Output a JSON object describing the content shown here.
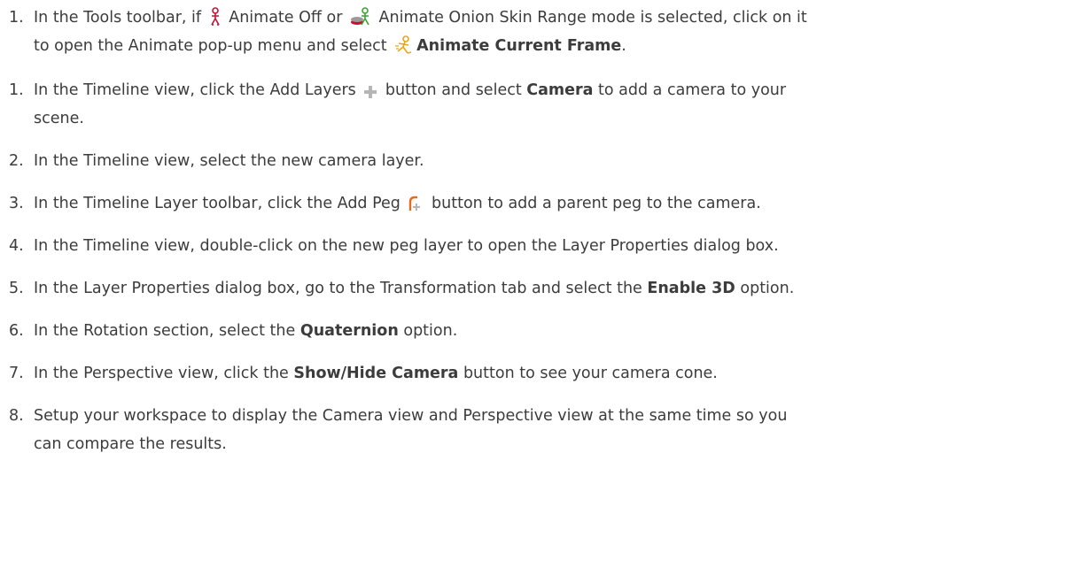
{
  "steps": [
    {
      "number": "1.",
      "pre": "In the Tools toolbar, if ",
      "t1": " Animate Off or ",
      "t2": " Animate Onion Skin Range mode is selected, click on it",
      "line2": "to open the Animate pop-up menu and select ",
      "bold": "Animate Current Frame",
      "end": ".",
      "icons": [
        "animate-off-icon",
        "animate-onion-skin-range-icon",
        "animate-current-frame-icon"
      ]
    },
    {
      "number": "1.",
      "pre": "In the Timeline view, click the Add Layers ",
      "mid": " button and select ",
      "bold": "Camera",
      "post": " to add a camera to your",
      "line2": "scene.",
      "icons": [
        "add-layers-icon"
      ]
    },
    {
      "number": "2.",
      "text": "In the Timeline view, select the new camera layer."
    },
    {
      "number": "3.",
      "pre": "In the Timeline Layer toolbar, click the Add Peg ",
      "post": " button to add a parent peg to the camera.",
      "icons": [
        "add-peg-icon"
      ]
    },
    {
      "number": "4.",
      "text": "In the Timeline view, double-click on the new peg layer to open the Layer Properties dialog box."
    },
    {
      "number": "5.",
      "pre": "In the Layer Properties dialog box, go to the Transformation tab and select the ",
      "bold": "Enable 3D",
      "post": " option."
    },
    {
      "number": "6.",
      "pre": "In the Rotation section, select the ",
      "bold": "Quaternion",
      "post": " option."
    },
    {
      "number": "7.",
      "pre": "In the Perspective view, click the ",
      "bold": "Show/Hide Camera",
      "post": " button to see your camera cone."
    },
    {
      "number": "8.",
      "text": "Setup your workspace to display the Camera view and Perspective view at the same time so you",
      "line2": "can compare the results."
    }
  ],
  "colors": {
    "text": "#3c3c3c",
    "animate_off_icon": "#c8102e",
    "onion_skin_figure": "#3ba534",
    "onion_skin_disc": "#c8102e",
    "current_frame_icon": "#e6a817",
    "add_layers_icon": "#b5b5b5",
    "add_peg_icon": "#e36b1c"
  }
}
